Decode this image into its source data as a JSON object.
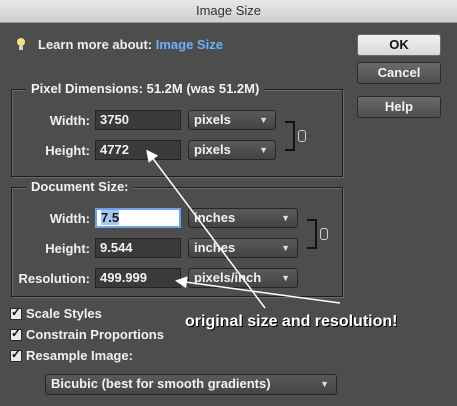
{
  "window": {
    "title": "Image Size"
  },
  "learn": {
    "prefix": "Learn more about:",
    "link": "Image Size"
  },
  "buttons": {
    "ok": "OK",
    "cancel": "Cancel",
    "help": "Help"
  },
  "pixel_dimensions": {
    "legend": "Pixel Dimensions:  51.2M (was 51.2M)",
    "width_label": "Width:",
    "width_value": "3750",
    "width_unit": "pixels",
    "height_label": "Height:",
    "height_value": "4772",
    "height_unit": "pixels"
  },
  "document_size": {
    "legend": "Document Size:",
    "width_label": "Width:",
    "width_value": "7.5",
    "width_unit": "inches",
    "height_label": "Height:",
    "height_value": "9.544",
    "height_unit": "inches",
    "resolution_label": "Resolution:",
    "resolution_value": "499.999",
    "resolution_unit": "pixels/inch"
  },
  "options": {
    "scale_styles": "Scale Styles",
    "constrain_proportions": "Constrain Proportions",
    "resample_image": "Resample Image:",
    "resample_method": "Bicubic (best for smooth gradients)"
  },
  "annotation": "original size and resolution!",
  "colors": {
    "link": "#6ab2ff",
    "dialog_bg": "#4d4d4d"
  }
}
